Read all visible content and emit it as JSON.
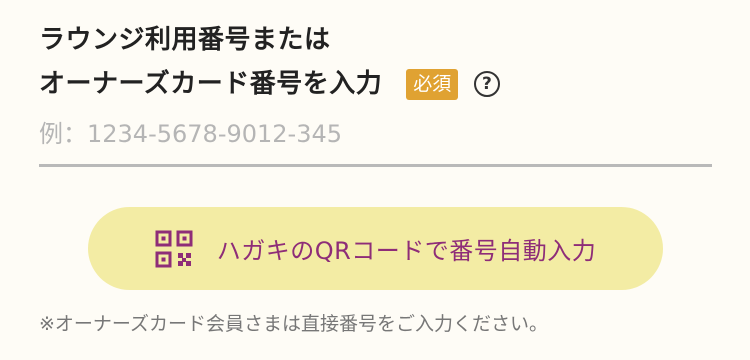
{
  "form": {
    "label_line1": "ラウンジ利用番号または",
    "label_line2": "オーナーズカード番号を入力",
    "required_badge": "必須",
    "help_icon_text": "?",
    "input": {
      "placeholder": "例：1234-5678-9012-345",
      "value": ""
    },
    "qr_button_label": "ハガキのQRコードで番号自動入力",
    "note": "※オーナーズカード会員さまは直接番号をご入力ください。"
  },
  "colors": {
    "badge": "#e0a232",
    "button_bg": "#f3eca4",
    "button_text": "#8e2d78",
    "input_underline": "#b9b9b9"
  },
  "icons": {
    "qr": "qr-code-icon",
    "help": "help-circle-icon"
  }
}
